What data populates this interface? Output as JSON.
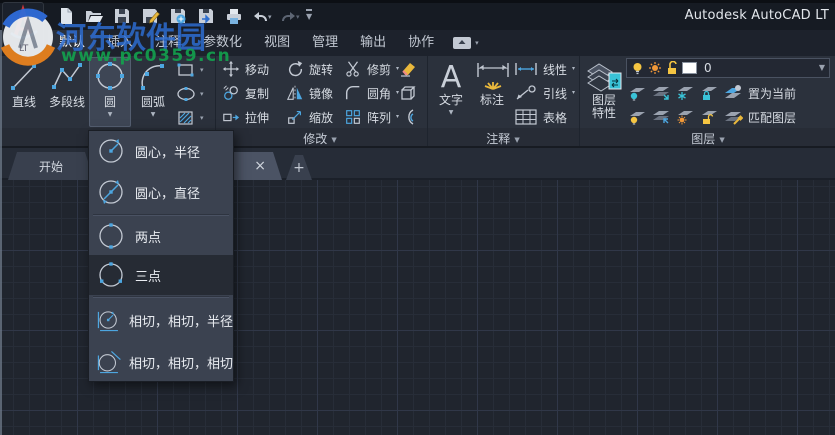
{
  "window": {
    "title": "Autodesk AutoCAD LT"
  },
  "watermark": {
    "site_name": "河东软件园",
    "site_url": "www.pc0359.cn",
    "logo": "pc0359-logo",
    "name_color": "#2e6fd6",
    "url_color": "#13a24e"
  },
  "quick_access": {
    "icons": [
      "new-file",
      "open-folder",
      "save",
      "save-as",
      "save-to-web",
      "batch-plot",
      "plot",
      "undo",
      "redo",
      "customize"
    ]
  },
  "ribbon_tabs": {
    "active": "默认",
    "items": [
      {
        "label": "默认"
      },
      {
        "label": "插入"
      },
      {
        "label": "注释"
      },
      {
        "label": "参数化"
      },
      {
        "label": "视图"
      },
      {
        "label": "管理"
      },
      {
        "label": "输出"
      },
      {
        "label": "协作"
      }
    ]
  },
  "ribbon": {
    "draw_panel": {
      "buttons": [
        {
          "label": "直线",
          "icon": "line"
        },
        {
          "label": "多段线",
          "icon": "polyline"
        },
        {
          "label": "圆",
          "icon": "circle",
          "dropdown": true,
          "open": true
        },
        {
          "label": "圆弧",
          "icon": "arc",
          "dropdown": true
        }
      ],
      "side_buttons": [
        {
          "icon": "rectangle",
          "dropdown": true
        },
        {
          "icon": "ellipse",
          "dropdown": true
        },
        {
          "icon": "hatch",
          "dropdown": true
        }
      ]
    },
    "modify_panel": {
      "label": "修改",
      "tools": [
        {
          "label": "移动",
          "icon": "move"
        },
        {
          "label": "旋转",
          "icon": "rotate"
        },
        {
          "label": "修剪",
          "icon": "trim",
          "dropdown": true
        },
        {
          "icon": "erase"
        },
        {
          "label": "复制",
          "icon": "copy"
        },
        {
          "label": "镜像",
          "icon": "mirror"
        },
        {
          "label": "圆角",
          "icon": "fillet",
          "dropdown": true
        },
        {
          "icon": "explode"
        },
        {
          "label": "拉伸",
          "icon": "stretch"
        },
        {
          "label": "缩放",
          "icon": "scale"
        },
        {
          "label": "阵列",
          "icon": "array",
          "dropdown": true
        },
        {
          "icon": "offset"
        }
      ]
    },
    "annotation_panel": {
      "label": "注释",
      "buttons": [
        {
          "label": "文字",
          "icon": "text",
          "dropdown": true
        },
        {
          "label": "标注",
          "icon": "dimension"
        }
      ],
      "side_tools": [
        {
          "label": "线性",
          "icon": "linear-dim",
          "dropdown": true
        },
        {
          "label": "引线",
          "icon": "leader",
          "dropdown": true
        },
        {
          "label": "表格",
          "icon": "table"
        }
      ]
    },
    "layers_panel": {
      "label": "图层",
      "properties_button": {
        "line1": "图层",
        "line2": "特性",
        "icon": "layer-properties"
      },
      "layer_combo": {
        "value": "0",
        "swatch_color": "#ffffff",
        "icons": [
          "bulb-on",
          "sun",
          "unlock"
        ]
      },
      "tool_rows": [
        {
          "icons": [
            "layer-off",
            "layer-isolate",
            "layer-freeze",
            "layer-lock",
            "set-current"
          ],
          "label": "置为当前"
        },
        {
          "icons": [
            "layer-on",
            "layer-unisolate",
            "layer-thaw",
            "layer-unlock",
            "match-layer"
          ],
          "label": "匹配图层"
        }
      ]
    }
  },
  "circle_menu": {
    "items": [
      {
        "label": "圆心，半径",
        "icon": "circle-center-radius"
      },
      {
        "label": "圆心，直径",
        "icon": "circle-center-diameter"
      },
      {
        "label": "两点",
        "icon": "circle-2-point",
        "separator_before": true
      },
      {
        "label": "三点",
        "icon": "circle-3-point",
        "highlighted": true
      },
      {
        "label": "相切，相切，半径",
        "icon": "circle-tan-tan-radius",
        "separator_before": true
      },
      {
        "label": "相切，相切，相切",
        "icon": "circle-tan-tan-tan"
      }
    ]
  },
  "file_tabs": {
    "start_tab": "开始",
    "active_tab_close": "×",
    "new_tab": "+"
  },
  "colors": {
    "ribbon_bg": "#2b313c",
    "canvas_bg": "#20252e",
    "menu_bg": "#3b4250",
    "accent_blue": "#4da6e0",
    "icon_gray": "#c3c9d3",
    "highlight_row": "#262b34",
    "yellow": "#e9b83c"
  }
}
